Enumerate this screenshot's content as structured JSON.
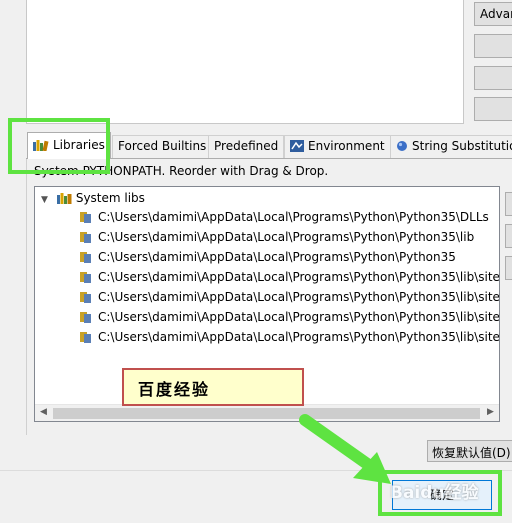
{
  "top_buttons": {
    "advanced_label": "Advar"
  },
  "tabs": [
    {
      "label": "Libraries",
      "icon": "books-icon",
      "active": true
    },
    {
      "label": "Forced Builtins",
      "active": false
    },
    {
      "label": "Predefined",
      "active": false
    },
    {
      "label": "Environment",
      "icon": "environment-icon",
      "active": false
    },
    {
      "label": "String Substitutio",
      "icon": "blue-dot-icon",
      "active": false
    }
  ],
  "description": "System PYTHONPATH.   Reorder with Drag & Drop.",
  "tree": {
    "root": {
      "label": "System libs",
      "expanded": true
    },
    "children": [
      "C:\\Users\\damimi\\AppData\\Local\\Programs\\Python\\Python35\\DLLs",
      "C:\\Users\\damimi\\AppData\\Local\\Programs\\Python\\Python35\\lib",
      "C:\\Users\\damimi\\AppData\\Local\\Programs\\Python\\Python35",
      "C:\\Users\\damimi\\AppData\\Local\\Programs\\Python\\Python35\\lib\\site-",
      "C:\\Users\\damimi\\AppData\\Local\\Programs\\Python\\Python35\\lib\\site-",
      "C:\\Users\\damimi\\AppData\\Local\\Programs\\Python\\Python35\\lib\\site-",
      "C:\\Users\\damimi\\AppData\\Local\\Programs\\Python\\Python35\\lib\\site-"
    ]
  },
  "restore_defaults_label": "恢复默认值(D)",
  "ok_label": "确定",
  "callout_text": "百度经验",
  "watermark_text": "Baidu经验",
  "colors": {
    "highlight_green": "#5ee341",
    "callout_border": "#c0504d",
    "callout_bg": "#ffffcc",
    "window_bg": "#f0f0f0"
  }
}
